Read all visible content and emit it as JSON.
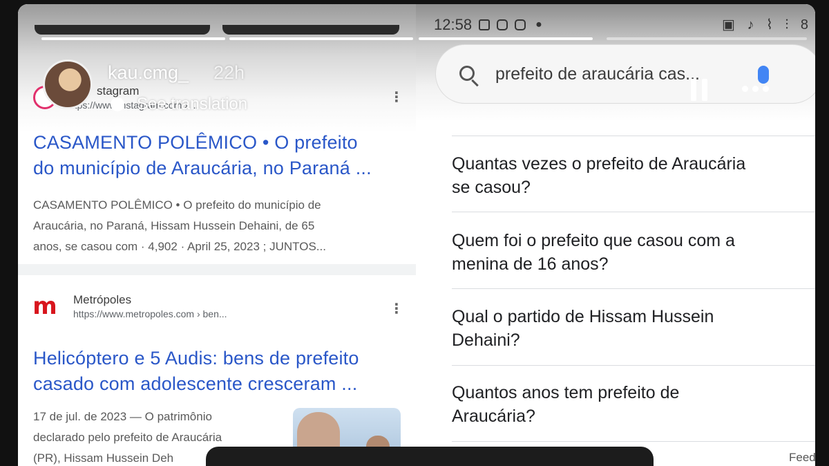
{
  "story": {
    "username": "kau.cmg_",
    "time": "22h",
    "translate_label": "See translation"
  },
  "status_bar": {
    "time": "12:58",
    "right_text": "8"
  },
  "search": {
    "query": "prefeito de araucária cas..."
  },
  "results": [
    {
      "source": "Instagram",
      "source_partial": "stagram",
      "url": "https://www.instagram.com › ...",
      "title_line1": "CASAMENTO POLÊMICO • O prefeito",
      "title_line2": "do município de Araucária, no Paraná ...",
      "snippet_line1": "CASAMENTO POLÊMICO • O prefeito do município de",
      "snippet_line2": "Araucária, no Paraná, Hissam Hussein Dehaini, de 65",
      "snippet_line3": "anos, se casou com · 4,902 · April 25, 2023 ; JUNTOS..."
    },
    {
      "source": "Metrópoles",
      "url": "https://www.metropoles.com › ben...",
      "title_line1": "Helicóptero e 5 Audis: bens de prefeito",
      "title_line2": "casado com adolescente cresceram ...",
      "snippet_line1": "17 de jul. de 2023 — O patrimônio",
      "snippet_line2": "declarado pelo prefeito de Araucária",
      "snippet_line3": "(PR), Hissam Hussein Deh"
    }
  ],
  "related_questions": [
    {
      "line1": "Quantas vezes o prefeito de Araucária",
      "line2": "se casou?"
    },
    {
      "line1": "Quem foi o prefeito que casou com a",
      "line2": "menina de 16 anos?"
    },
    {
      "line1": "Qual o partido de Hissam Hussein",
      "line2": "Dehaini?"
    },
    {
      "line1": "Quantos anos tem prefeito de",
      "line2": "Araucária?"
    }
  ],
  "footer": {
    "feedback_partial": "Feed"
  },
  "colors": {
    "link_blue": "#2a57c8",
    "instagram": "#e1306c",
    "metropoles_red": "#d8151d",
    "mic_blue": "#4285f4"
  },
  "icons": [
    "instagram-icon",
    "metropoles-icon",
    "kebab-icon",
    "search-icon",
    "mic-icon",
    "pause-icon",
    "more-icon"
  ]
}
